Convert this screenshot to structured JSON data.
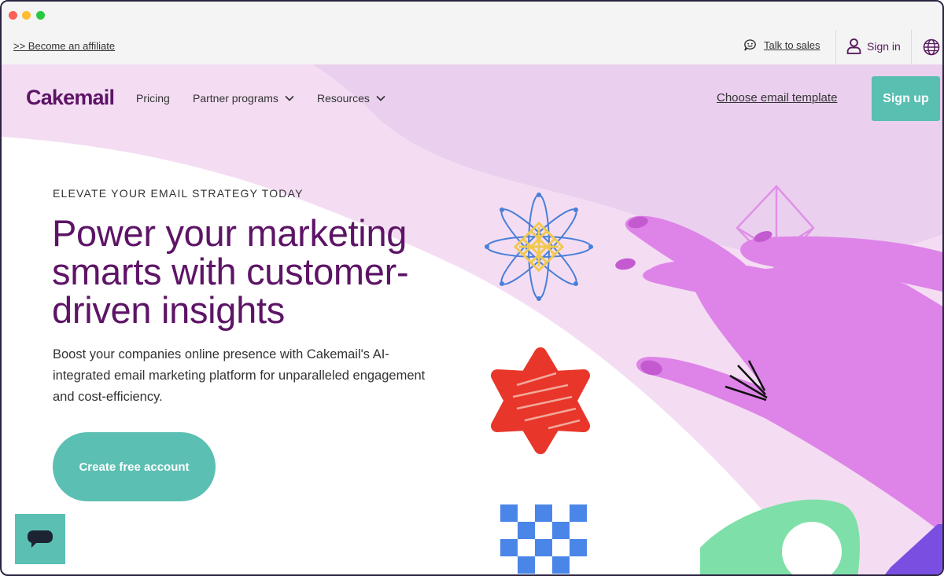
{
  "utility_bar": {
    "affiliate_link": ">> Become an affiliate",
    "talk_to_sales": "Talk to sales",
    "sign_in": "Sign in"
  },
  "nav": {
    "logo": "Cakemail",
    "items": [
      {
        "label": "Pricing",
        "has_dropdown": false
      },
      {
        "label": "Partner programs",
        "has_dropdown": true
      },
      {
        "label": "Resources",
        "has_dropdown": true
      }
    ],
    "choose_template": "Choose email template",
    "signup": "Sign up"
  },
  "hero": {
    "eyebrow": "ELEVATE YOUR EMAIL STRATEGY TODAY",
    "headline": "Power your marketing smarts with customer-driven insights",
    "subtext": "Boost your companies online presence with Cakemail's AI-integrated email marketing platform for unparalleled engagement and cost-efficiency.",
    "cta": "Create free account"
  },
  "colors": {
    "brand_purple": "#5d1466",
    "teal": "#59bfb1",
    "hero_lavender": "#f4ddf3",
    "hand_pink": "#de84e8"
  },
  "icons": [
    "chat-bubble-icon",
    "user-icon",
    "globe-icon",
    "chevron-down-icon",
    "chat-widget-icon"
  ]
}
